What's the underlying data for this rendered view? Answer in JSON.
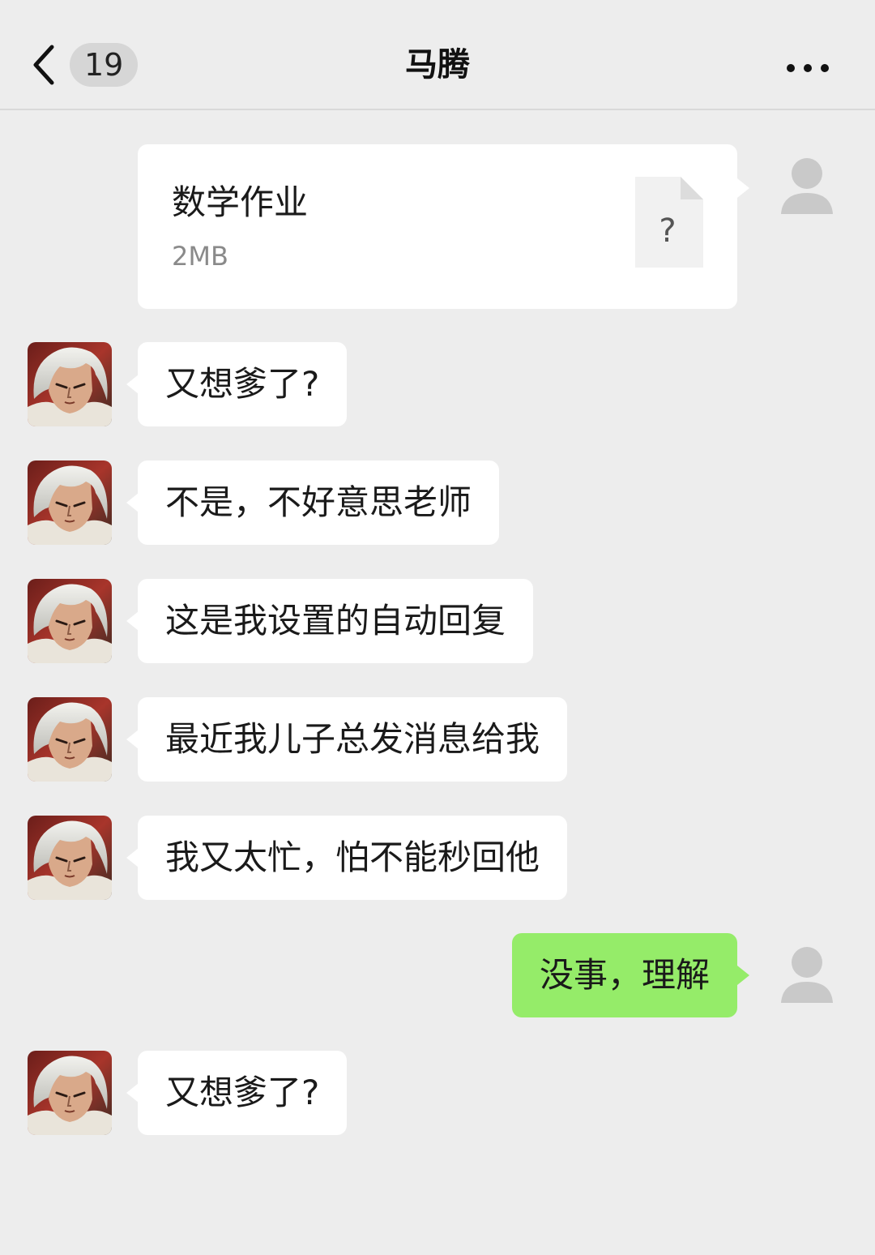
{
  "header": {
    "unread_count": "19",
    "title": "马腾",
    "back_icon": "chevron-left-icon",
    "more_icon": "more-dots-icon"
  },
  "colors": {
    "background": "#ededed",
    "bubble_incoming": "#ffffff",
    "bubble_outgoing": "#95ec69"
  },
  "messages": [
    {
      "sender": "self",
      "type": "file",
      "file_name": "数学作业",
      "file_size": "2MB",
      "file_icon_glyph": "?"
    },
    {
      "sender": "contact",
      "type": "text",
      "text": "又想爹了?"
    },
    {
      "sender": "contact",
      "type": "text",
      "text": "不是，不好意思老师"
    },
    {
      "sender": "contact",
      "type": "text",
      "text": "这是我设置的自动回复"
    },
    {
      "sender": "contact",
      "type": "text",
      "text": "最近我儿子总发消息给我"
    },
    {
      "sender": "contact",
      "type": "text",
      "text": "我又太忙，怕不能秒回他"
    },
    {
      "sender": "self",
      "type": "text",
      "text": "没事，理解"
    },
    {
      "sender": "contact",
      "type": "text",
      "text": "又想爹了?"
    }
  ]
}
